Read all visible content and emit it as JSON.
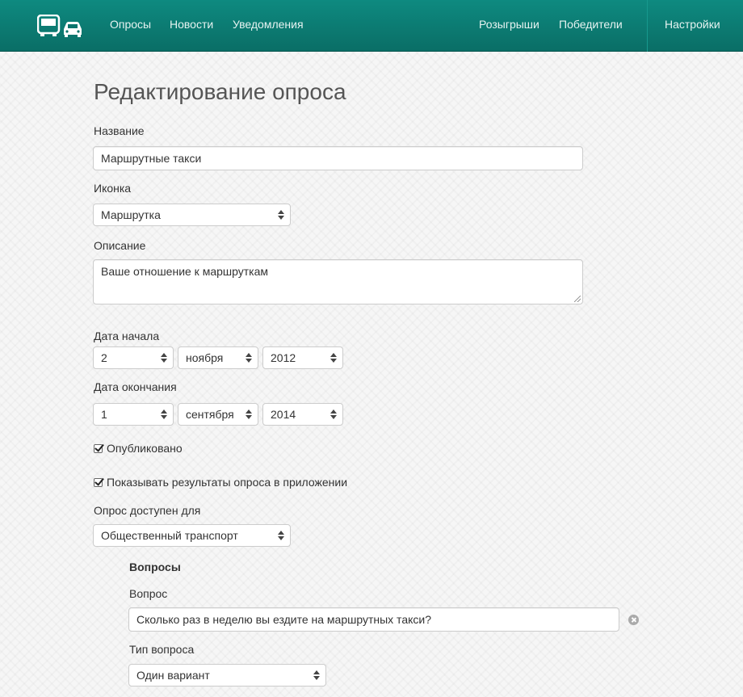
{
  "navbar": {
    "brand_icons": [
      "bus-icon",
      "car-icon"
    ],
    "left_links": [
      "Опросы",
      "Новости",
      "Уведомления"
    ],
    "right_links": [
      "Розыгрыши",
      "Победители"
    ],
    "settings": "Настройки",
    "background": "#0d7f76"
  },
  "form": {
    "title": "Редактирование опроса",
    "name_label": "Название",
    "name_value": "Маршрутные такси",
    "icon_label": "Иконка",
    "icon_value": "Маршрутка",
    "description_label": "Описание",
    "description_value": "Ваше отношение к маршруткам",
    "start_label": "Дата начала",
    "start_day": "2",
    "start_month": "ноября",
    "start_year": "2012",
    "end_label": "Дата окончания",
    "end_day": "1",
    "end_month": "сентября",
    "end_year": "2014",
    "published_label": "Опубликовано",
    "published_checked": true,
    "show_results_label": "Показывать результаты опроса в приложении",
    "show_results_checked": true,
    "available_label": "Опрос доступен для",
    "available_value": "Общественный транспорт"
  },
  "questions": {
    "heading": "Вопросы",
    "question_label": "Вопрос",
    "question_value": "Сколько раз в неделю вы ездите на маршрутных такси?",
    "type_label": "Тип вопроса",
    "type_value": "Один вариант"
  }
}
